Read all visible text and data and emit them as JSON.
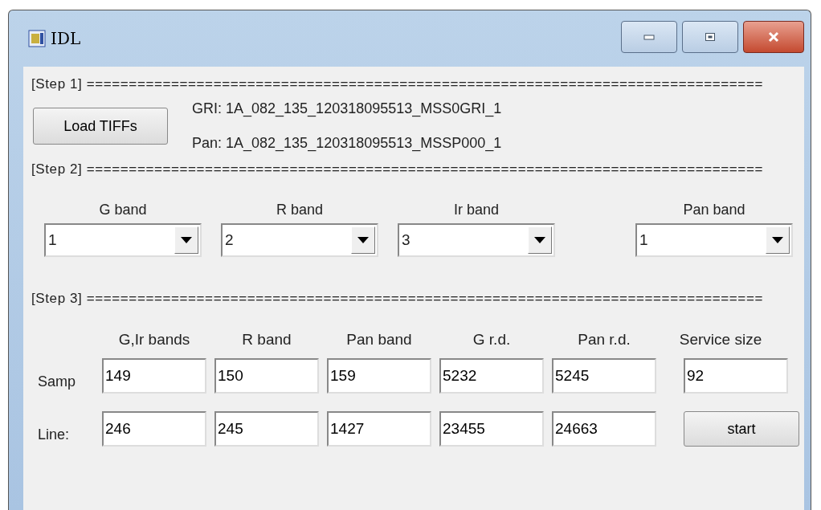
{
  "window": {
    "title": "IDL"
  },
  "step1": {
    "header": "[Step 1] ================================================================================",
    "button": "Load TIFFs",
    "files": [
      "GRI: 1A_082_135_120318095513_MSS0GRI_1",
      "Pan: 1A_082_135_120318095513_MSSP000_1"
    ]
  },
  "step2": {
    "header": "[Step 2] ================================================================================",
    "bands": [
      {
        "label": "G band",
        "value": "1"
      },
      {
        "label": "R band",
        "value": "2"
      },
      {
        "label": "Ir band",
        "value": "3"
      },
      {
        "label": "Pan band",
        "value": "1"
      }
    ]
  },
  "step3": {
    "header": "[Step 3] ================================================================================",
    "columns": [
      "G,Ir bands",
      "R band",
      "Pan band",
      "G r.d.",
      "Pan r.d.",
      "Service size"
    ],
    "rows": [
      {
        "label": "Samp",
        "values": [
          "149",
          "150",
          "159",
          "5232",
          "5245",
          "92"
        ]
      },
      {
        "label": "Line:",
        "values": [
          "246",
          "245",
          "1427",
          "23455",
          "24663"
        ]
      }
    ],
    "button": "start"
  }
}
